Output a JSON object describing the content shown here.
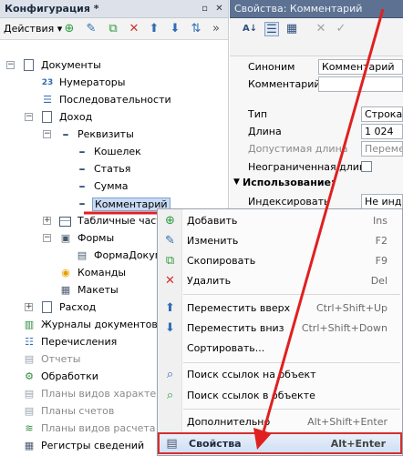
{
  "config_panel": {
    "title": "Конфигурация *",
    "actions_label": "Действия ▾",
    "tree": [
      {
        "label": "Документы",
        "icon": "documents-icon"
      },
      {
        "label": "Нумераторы",
        "icon": "numerators-icon"
      },
      {
        "label": "Последовательности",
        "icon": "sequences-icon"
      },
      {
        "label": "Доход",
        "icon": "document-icon"
      },
      {
        "label": "Реквизиты",
        "icon": "attributes-icon"
      },
      {
        "label": "Кошелек",
        "icon": "attribute-icon"
      },
      {
        "label": "Статья",
        "icon": "attribute-icon"
      },
      {
        "label": "Сумма",
        "icon": "attribute-icon"
      },
      {
        "label": "Комментарий",
        "icon": "attribute-icon"
      },
      {
        "label": "Табличные части",
        "icon": "table-icon"
      },
      {
        "label": "Формы",
        "icon": "forms-icon"
      },
      {
        "label": "ФормаДокумента",
        "icon": "form-icon"
      },
      {
        "label": "Команды",
        "icon": "commands-icon"
      },
      {
        "label": "Макеты",
        "icon": "templates-icon"
      },
      {
        "label": "Расход",
        "icon": "document-icon"
      },
      {
        "label": "Журналы документов",
        "icon": "journals-icon"
      },
      {
        "label": "Перечисления",
        "icon": "enums-icon"
      },
      {
        "label": "Отчеты",
        "icon": "reports-icon"
      },
      {
        "label": "Обработки",
        "icon": "dataprocessors-icon"
      },
      {
        "label": "Планы видов характеристик",
        "icon": "chart-of-characteristics-icon"
      },
      {
        "label": "Планы счетов",
        "icon": "chart-of-accounts-icon"
      },
      {
        "label": "Планы видов расчета",
        "icon": "chart-of-calculation-icon"
      },
      {
        "label": "Регистры сведений",
        "icon": "information-registers-icon"
      }
    ]
  },
  "properties_panel": {
    "title": "Свойства: Комментарий",
    "rows": {
      "synonym_label": "Синоним",
      "synonym_value": "Комментарий",
      "comment_label": "Комментарий",
      "type_label": "Тип",
      "type_value": "Строка",
      "length_label": "Длина",
      "length_value": "1 024",
      "allowed_length_label": "Допустимая длина",
      "allowed_length_value": "Переменная",
      "unlimited_label": "Неограниченная длина",
      "usage_group": "Использование:",
      "index_label": "Индексировать",
      "index_value": "Не индексировать"
    }
  },
  "context_menu": {
    "items": [
      {
        "label": "Добавить",
        "shortcut": "Ins",
        "icon": "add-icon"
      },
      {
        "label": "Изменить",
        "shortcut": "F2",
        "icon": "edit-icon"
      },
      {
        "label": "Скопировать",
        "shortcut": "F9",
        "icon": "copy-icon"
      },
      {
        "label": "Удалить",
        "shortcut": "Del",
        "icon": "delete-icon"
      },
      {
        "label": "Переместить вверх",
        "shortcut": "Ctrl+Shift+Up",
        "icon": "move-up-icon"
      },
      {
        "label": "Переместить вниз",
        "shortcut": "Ctrl+Shift+Down",
        "icon": "move-down-icon"
      },
      {
        "label": "Сортировать...",
        "shortcut": "",
        "icon": "sort-icon"
      },
      {
        "label": "Поиск ссылок на объект",
        "shortcut": "",
        "icon": "find-refs-icon"
      },
      {
        "label": "Поиск ссылок в объекте",
        "shortcut": "",
        "icon": "find-refs-in-icon"
      },
      {
        "label": "Дополнительно",
        "shortcut": "Alt+Shift+Enter",
        "icon": "more-icon"
      },
      {
        "label": "Свойства",
        "shortcut": "Alt+Enter",
        "icon": "properties-icon"
      }
    ]
  },
  "colors": {
    "annotation_red": "#e02020",
    "selection_blue": "#c8daf3",
    "props_title": "#5d7293"
  }
}
